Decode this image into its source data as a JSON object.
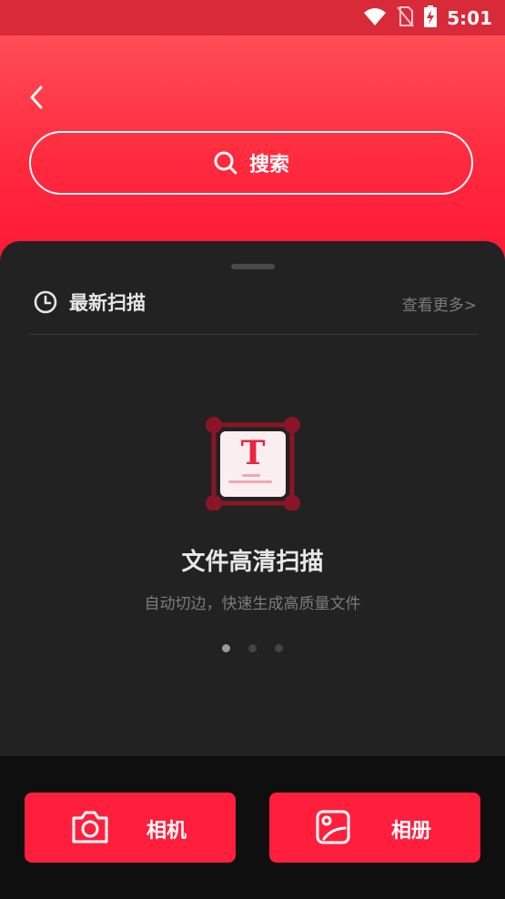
{
  "status_bar": {
    "time": "5:01"
  },
  "header": {
    "search_label": "搜索"
  },
  "recent": {
    "title": "最新扫描",
    "see_more": "查看更多>"
  },
  "feature": {
    "title": "文件高清扫描",
    "subtitle": "自动切边，快速生成高质量文件",
    "icon_letter": "T",
    "page_index": 1,
    "page_count": 3
  },
  "actions": {
    "camera_label": "相机",
    "album_label": "相册"
  },
  "colors": {
    "accent": "#ff1f3d",
    "header_top": "#ff4d56",
    "sheet": "#222222",
    "background": "#0f0f0f"
  }
}
